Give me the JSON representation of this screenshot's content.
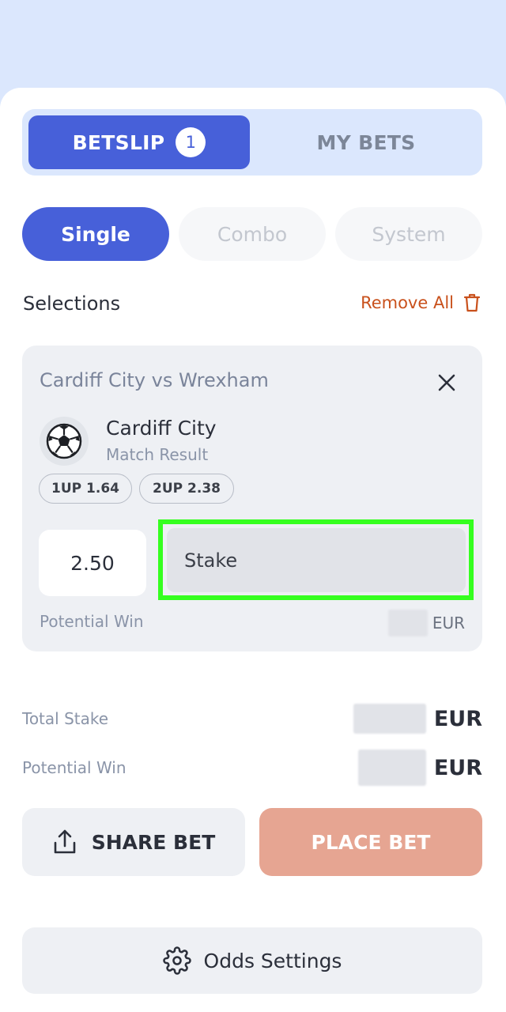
{
  "tabs": {
    "betslip_label": "BETSLIP",
    "betslip_count": "1",
    "mybets_label": "MY BETS"
  },
  "bet_types": {
    "single": "Single",
    "combo": "Combo",
    "system": "System",
    "active": "Single"
  },
  "selections": {
    "title": "Selections",
    "remove_all": "Remove All"
  },
  "selection_card": {
    "event": "Cardiff City vs Wrexham",
    "team": "Cardiff City",
    "market": "Match Result",
    "chips": [
      "1UP 1.64",
      "2UP 2.38"
    ],
    "odds": "2.50",
    "stake_placeholder": "Stake",
    "potential_win_label": "Potential Win",
    "potential_win_currency": "EUR"
  },
  "totals": {
    "total_stake_label": "Total Stake",
    "total_stake_currency": "EUR",
    "potential_win_label": "Potential Win",
    "potential_win_currency": "EUR"
  },
  "actions": {
    "share_label": "SHARE BET",
    "place_label": "PLACE BET",
    "odds_settings_label": "Odds Settings"
  },
  "colors": {
    "accent": "#4760d9",
    "background": "#dbe7fd",
    "place_bet": "#e6a592",
    "remove_all": "#c9511c",
    "stake_highlight": "#35ff1f"
  },
  "icons": {
    "remove_all": "trash-icon",
    "close": "close-icon",
    "sport": "soccer-ball-icon",
    "share": "share-icon",
    "settings": "gear-icon"
  }
}
